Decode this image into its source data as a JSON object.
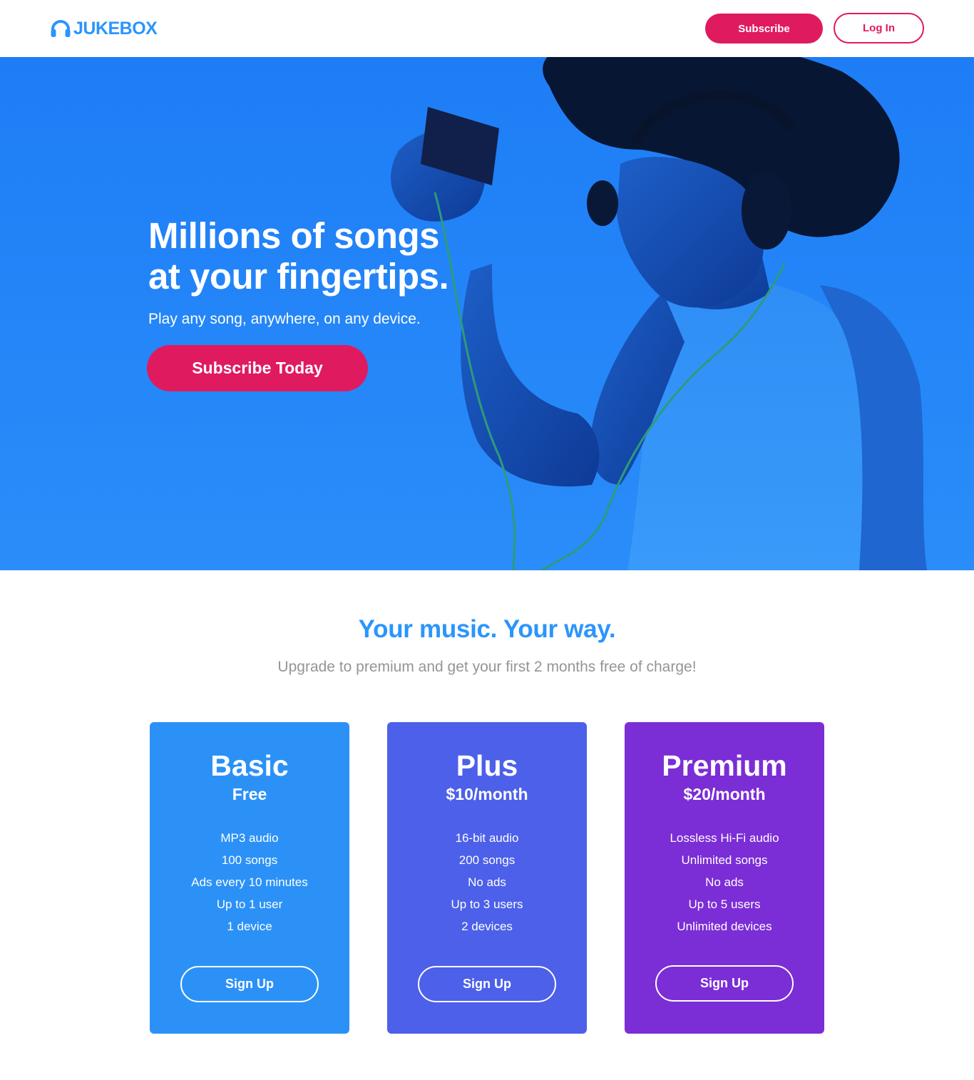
{
  "colors": {
    "brand_blue": "#2B95FD",
    "accent_pink": "#E01A5E",
    "subtitle_gray": "#959595",
    "hero_blue": "#2486F8",
    "card_basic": "#2B91F7",
    "card_plus": "#4C60EA",
    "card_premium": "#7B2DD6",
    "white": "#FFFFFF"
  },
  "header": {
    "logo_icon": "headphones-icon",
    "logo_text": "JUKEBOX",
    "subscribe_label": "Subscribe",
    "login_label": "Log In"
  },
  "hero": {
    "image": "woman-with-headphones-photo",
    "title_line1": "Millions of songs",
    "title_line2": "at your fingertips.",
    "subtitle": "Play any song, anywhere, on any device.",
    "cta_label": "Subscribe Today"
  },
  "plans_section": {
    "title": "Your music. Your way.",
    "subtitle": "Upgrade to premium and get your first 2 months free of charge!",
    "plans": [
      {
        "name": "Basic",
        "price": "Free",
        "features": [
          "MP3 audio",
          "100 songs",
          "Ads every 10 minutes",
          "Up to 1 user",
          "1 device"
        ],
        "button_label": "Sign Up"
      },
      {
        "name": "Plus",
        "price": "$10/month",
        "features": [
          "16-bit audio",
          "200 songs",
          "No ads",
          "Up to 3 users",
          "2 devices"
        ],
        "button_label": "Sign Up"
      },
      {
        "name": "Premium",
        "price": "$20/month",
        "features": [
          "Lossless Hi-Fi audio",
          "Unlimited songs",
          "No ads",
          "Up to 5 users",
          "Unlimited devices"
        ],
        "button_label": "Sign Up"
      }
    ]
  }
}
